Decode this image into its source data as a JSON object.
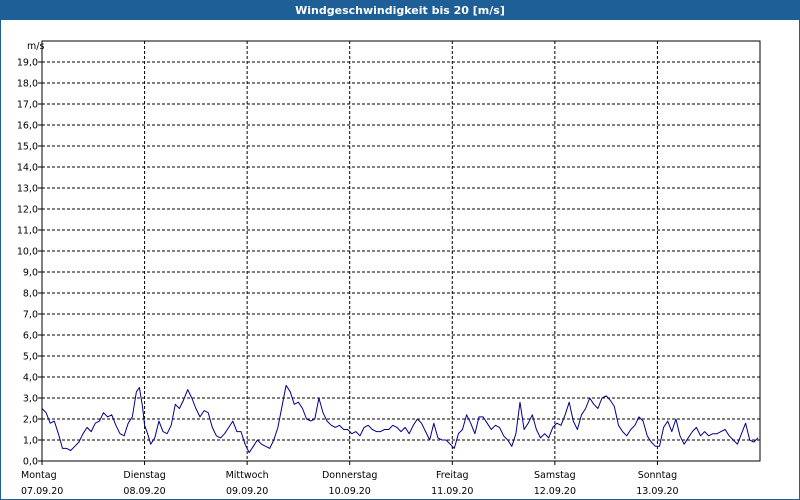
{
  "window": {
    "title": "Windgeschwindigkeit bis 20 [m/s]"
  },
  "chart_data": {
    "type": "line",
    "title": "Windgeschwindigkeit bis 20 [m/s]",
    "ylabel": "m/s",
    "ylim": [
      0,
      20
    ],
    "yticks": [
      "0,0",
      "1,0",
      "2,0",
      "3,0",
      "4,0",
      "5,0",
      "6,0",
      "7,0",
      "8,0",
      "9,0",
      "10,0",
      "11,0",
      "12,0",
      "13,0",
      "14,0",
      "15,0",
      "16,0",
      "17,0",
      "18,0",
      "19,0"
    ],
    "xlim": [
      0,
      7
    ],
    "x_ticks": [
      {
        "day": "Montag",
        "date": "07.09.20"
      },
      {
        "day": "Dienstag",
        "date": "08.09.20"
      },
      {
        "day": "Mittwoch",
        "date": "09.09.20"
      },
      {
        "day": "Donnerstag",
        "date": "10.09.20"
      },
      {
        "day": "Freitag",
        "date": "11.09.20"
      },
      {
        "day": "Samstag",
        "date": "12.09.20"
      },
      {
        "day": "Sonntag",
        "date": "13.09.20"
      }
    ],
    "grid": true,
    "colors": {
      "series": "#00008b",
      "grid": "#000000"
    },
    "series": [
      {
        "x": [
          0,
          0.04,
          0.08,
          0.12,
          0.16,
          0.2,
          0.24,
          0.28,
          0.32,
          0.36,
          0.4,
          0.44,
          0.48,
          0.52,
          0.56,
          0.6,
          0.64,
          0.68,
          0.72,
          0.76,
          0.8,
          0.84,
          0.88,
          0.92,
          0.95,
          0.98,
          1.0,
          1.03,
          1.06,
          1.1,
          1.14,
          1.18,
          1.22,
          1.26,
          1.3,
          1.34,
          1.38,
          1.42,
          1.46,
          1.5,
          1.54,
          1.58,
          1.62,
          1.66,
          1.7,
          1.74,
          1.78,
          1.82,
          1.86,
          1.9,
          1.94,
          1.98,
          2.02,
          2.06,
          2.1,
          2.14,
          2.18,
          2.22,
          2.26,
          2.3,
          2.34,
          2.38,
          2.42,
          2.46,
          2.5,
          2.54,
          2.58,
          2.62,
          2.66,
          2.7,
          2.74,
          2.78,
          2.82,
          2.86,
          2.9,
          2.94,
          2.98,
          3.02,
          3.06,
          3.1,
          3.14,
          3.18,
          3.22,
          3.26,
          3.3,
          3.34,
          3.38,
          3.42,
          3.46,
          3.5,
          3.54,
          3.58,
          3.62,
          3.66,
          3.7,
          3.74,
          3.78,
          3.82,
          3.86,
          3.9,
          3.94,
          3.98,
          4.02,
          4.06,
          4.1,
          4.14,
          4.18,
          4.22,
          4.26,
          4.3,
          4.34,
          4.38,
          4.42,
          4.46,
          4.5,
          4.54,
          4.58,
          4.62,
          4.66,
          4.7,
          4.74,
          4.78,
          4.82,
          4.86,
          4.9,
          4.94,
          4.98,
          5.02,
          5.06,
          5.1,
          5.14,
          5.18,
          5.22,
          5.26,
          5.3,
          5.34,
          5.38,
          5.42,
          5.46,
          5.5,
          5.54,
          5.58,
          5.62,
          5.66,
          5.7,
          5.74,
          5.78,
          5.82,
          5.86,
          5.9,
          5.94,
          5.98,
          6.02,
          6.06,
          6.1,
          6.14,
          6.18,
          6.22,
          6.26,
          6.3,
          6.34,
          6.38,
          6.42,
          6.46,
          6.5,
          6.54,
          6.58,
          6.62,
          6.66,
          6.7,
          6.74,
          6.78,
          6.82,
          6.86,
          6.9,
          6.94,
          6.98
        ],
        "values": [
          2.5,
          2.3,
          1.8,
          1.9,
          1.3,
          0.6,
          0.6,
          0.5,
          0.7,
          0.9,
          1.3,
          1.6,
          1.4,
          1.8,
          1.9,
          2.3,
          2.1,
          2.2,
          1.7,
          1.3,
          1.2,
          1.8,
          2.1,
          3.3,
          3.5,
          2.6,
          1.7,
          1.3,
          0.8,
          1.1,
          1.9,
          1.4,
          1.3,
          1.7,
          2.7,
          2.5,
          2.9,
          3.4,
          3.0,
          2.5,
          2.1,
          2.4,
          2.3,
          1.6,
          1.2,
          1.1,
          1.3,
          1.6,
          1.9,
          1.4,
          1.4,
          0.8,
          0.4,
          0.7,
          1.0,
          0.8,
          0.7,
          0.6,
          1.0,
          1.6,
          2.6,
          3.6,
          3.3,
          2.7,
          2.8,
          2.5,
          2.0,
          1.9,
          2.0,
          3.0,
          2.3,
          1.9,
          1.7,
          1.6,
          1.7,
          1.5,
          1.5,
          1.3,
          1.4,
          1.2,
          1.6,
          1.7,
          1.5,
          1.4,
          1.4,
          1.5,
          1.5,
          1.7,
          1.6,
          1.4,
          1.6,
          1.3,
          1.7,
          2.0,
          1.8,
          1.4,
          1.0,
          1.8,
          1.1,
          1.0,
          1.0,
          0.8,
          0.6,
          1.3,
          1.5,
          2.2,
          1.8,
          1.3,
          2.1,
          2.1,
          1.8,
          1.5,
          1.7,
          1.6,
          1.2,
          1.0,
          0.7,
          1.3,
          2.8,
          1.5,
          1.8,
          2.2,
          1.5,
          1.1,
          1.3,
          1.1,
          1.6,
          1.8,
          1.7,
          2.2,
          2.8,
          1.9,
          1.5,
          2.2,
          2.5,
          3.0,
          2.7,
          2.5,
          3.0,
          3.1,
          2.9,
          2.6,
          1.7,
          1.4,
          1.2,
          1.5,
          1.7,
          2.1,
          1.9,
          1.2,
          0.9,
          0.7,
          0.7,
          1.6,
          1.9,
          1.4,
          2.0,
          1.2,
          0.8,
          1.1,
          1.4,
          1.6,
          1.2,
          1.4,
          1.2,
          1.3,
          1.3,
          1.4,
          1.5,
          1.2,
          1.0,
          0.8,
          1.3,
          1.8,
          1.0,
          0.9,
          1.1
        ]
      }
    ]
  }
}
